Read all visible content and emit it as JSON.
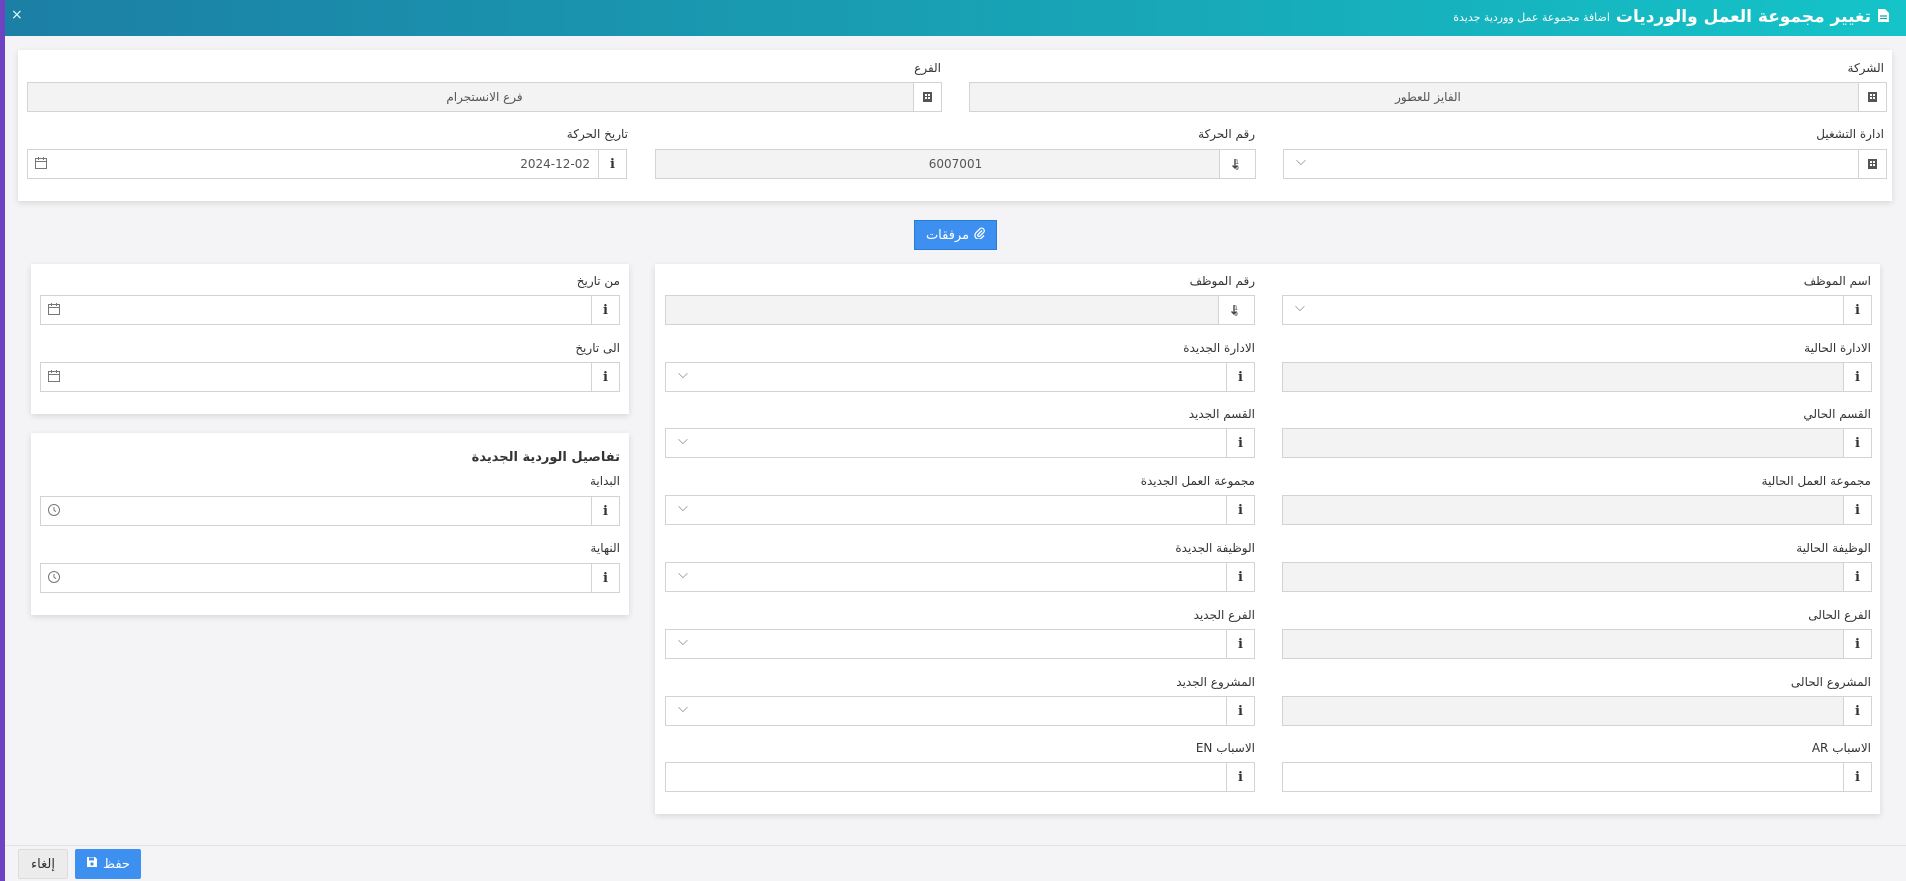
{
  "window": {
    "title": "تغيير مجموعة العمل والورديات",
    "subtitle": "اضافة مجموعة عمل ووردية جديدة",
    "close_glyph": "×"
  },
  "header_form": {
    "company": {
      "label": "الشركة",
      "value": "الفايز للعطور",
      "icon": "building-icon"
    },
    "branch": {
      "label": "الفرع",
      "value": "فرع الانستجرام",
      "icon": "building-icon"
    },
    "operation_admin": {
      "label": "ادارة التشغيل",
      "value": ""
    },
    "movement_number": {
      "label": "رقم الحركة",
      "value": "6007001"
    },
    "movement_date": {
      "label": "تاريخ الحركة",
      "value": "2024-12-02"
    }
  },
  "attachments_button": {
    "label": "مرفقات",
    "icon": "paperclip-icon"
  },
  "employee_form": {
    "employee_name": {
      "label": "اسم الموظف",
      "value": ""
    },
    "employee_number": {
      "label": "رقم الموظف",
      "value": ""
    },
    "current_admin": {
      "label": "الادارة الحالية",
      "value": ""
    },
    "new_admin": {
      "label": "الادارة الجديدة",
      "value": ""
    },
    "current_section": {
      "label": "القسم الحالي",
      "value": ""
    },
    "new_section": {
      "label": "القسم الجديد",
      "value": ""
    },
    "current_workgroup": {
      "label": "مجموعة العمل الحالية",
      "value": ""
    },
    "new_workgroup": {
      "label": "مجموعة العمل الجديدة",
      "value": ""
    },
    "current_job": {
      "label": "الوظيفة الحالية",
      "value": ""
    },
    "new_job": {
      "label": "الوظيفة الجديدة",
      "value": ""
    },
    "current_branch": {
      "label": "الفرع الحالى",
      "value": ""
    },
    "new_branch": {
      "label": "الفرع الجديد",
      "value": ""
    },
    "current_project": {
      "label": "المشروع الحالى",
      "value": ""
    },
    "new_project": {
      "label": "المشروع الجديد",
      "value": ""
    },
    "reasons_ar": {
      "label": "الاسباب AR",
      "value": ""
    },
    "reasons_en": {
      "label": "الاسباب EN",
      "value": ""
    }
  },
  "dates_form": {
    "from_date": {
      "label": "من تاريخ",
      "value": ""
    },
    "to_date": {
      "label": "الى تاريخ",
      "value": ""
    }
  },
  "shift_form": {
    "heading": "تفاصيل الوردية الجديدة",
    "start": {
      "label": "البداية",
      "value": ""
    },
    "end": {
      "label": "النهاية",
      "value": ""
    }
  },
  "footer": {
    "save_label": "حفظ",
    "cancel_label": "إلغاء"
  },
  "colors": {
    "title_gradient_start": "#1c7fa5",
    "title_gradient_end": "#14c4c8",
    "primary_button": "#3d8ff0",
    "left_accent": "#6f42c1"
  }
}
